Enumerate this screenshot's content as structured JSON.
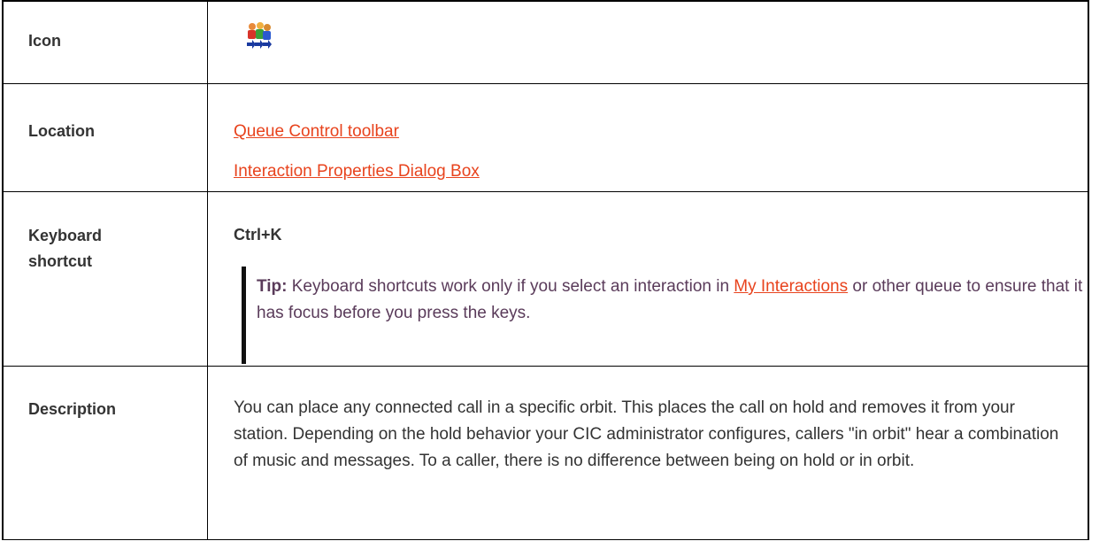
{
  "rows": {
    "icon": {
      "label": "Icon",
      "icon_name": "orbit-people-icon"
    },
    "location": {
      "label": "Location",
      "links": [
        "Queue Control toolbar",
        "Interaction Properties Dialog Box"
      ]
    },
    "keyboard": {
      "label_line1": "Keyboard",
      "label_line2": "shortcut",
      "shortcut": "Ctrl+K",
      "tip_label": "Tip:",
      "tip_text_before": " Keyboard shortcuts work only if you select an interaction in ",
      "tip_link": "My Interactions",
      "tip_text_after": " or other queue to ensure that it has focus before you press the keys."
    },
    "description": {
      "label": "Description",
      "text": "You can place any connected call in a specific orbit. This places the call on hold and removes it from your station. Depending on the hold behavior your CIC administrator configures, callers \"in orbit\" hear a combination of music and messages. To a caller, there is no difference between being on hold or in orbit."
    }
  },
  "colors": {
    "link": "#e8431d",
    "text": "#333333",
    "tip_text": "#5a3b5a"
  }
}
